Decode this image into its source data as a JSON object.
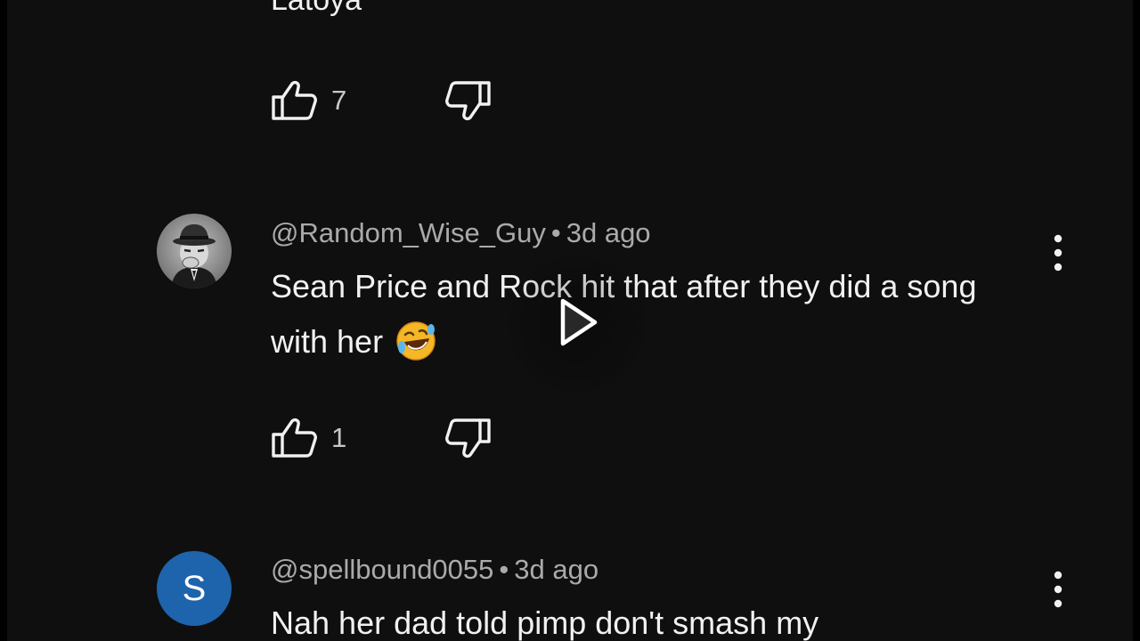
{
  "previous_comment": {
    "text_tail": "Latoya",
    "like_count": "7"
  },
  "comments": [
    {
      "author": "@Random_Wise_Guy",
      "separator": "•",
      "time": "3d ago",
      "text": "Sean Price and Rock hit that after they did a song with her",
      "emoji": "rolling-on-floor-laughing-emoji",
      "like_count": "1",
      "avatar_icon": "fedora-man-avatar-icon"
    },
    {
      "author": "@spellbound0055",
      "separator": "•",
      "time": "3d ago",
      "text": "Nah her dad told pimp don't smash my",
      "avatar_letter": "S",
      "avatar_color": "#1e64ad"
    }
  ],
  "icons": {
    "like": "thumbs-up-icon",
    "dislike": "thumbs-down-icon",
    "more": "more-vert-icon",
    "play": "play-icon"
  },
  "colors": {
    "background": "#0f0f0f",
    "text_primary": "#f1f1f1",
    "text_secondary": "#aaaaaa",
    "avatar_blue": "#1e64ad"
  }
}
